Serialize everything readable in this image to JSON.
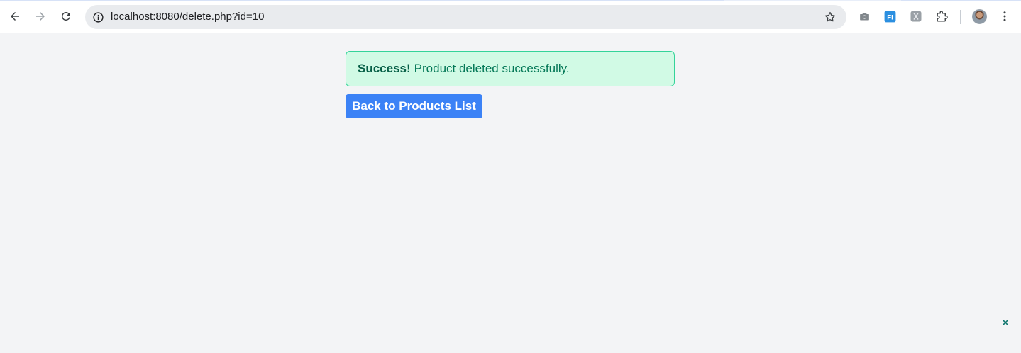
{
  "browser": {
    "url": "localhost:8080/delete.php?id=10",
    "icons": {
      "back": "arrow-left-icon",
      "forward": "arrow-right-icon",
      "reload": "reload-icon",
      "site_info": "info-icon",
      "bookmark": "star-icon",
      "screenshot": "camera-icon",
      "extension_1": "extension-fi-icon",
      "extension_2": "extension-gray-icon",
      "extensions": "puzzle-icon",
      "profile": "avatar",
      "menu": "kebab-menu-icon"
    },
    "extension_1_label": "FI"
  },
  "main": {
    "alert": {
      "strong": "Success!",
      "message": "Product deleted successfully."
    },
    "back_button": "Back to Products List"
  },
  "overlay": {
    "dismiss_glyph": "×"
  },
  "colors": {
    "page_bg": "#f3f4f6",
    "alert_bg": "#d1fae5",
    "alert_border": "#34d399",
    "alert_text": "#047857",
    "button_bg": "#3b82f6"
  }
}
